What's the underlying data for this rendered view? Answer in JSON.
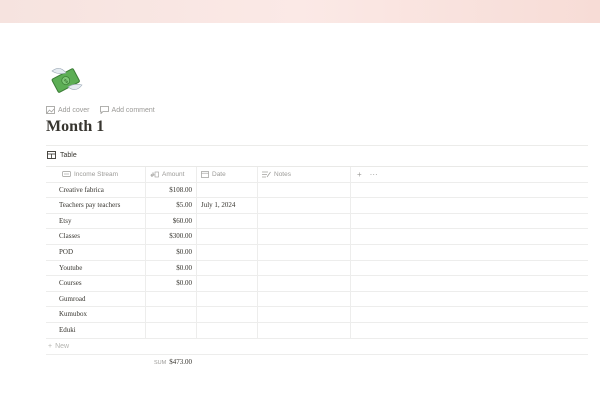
{
  "page": {
    "title": "Month 1",
    "cover_actions": {
      "add_cover": "Add cover",
      "add_comment": "Add comment"
    },
    "icon": "money-with-wings-icon",
    "cover_color": "#f6e3df"
  },
  "view": {
    "label": "Table"
  },
  "table": {
    "columns": [
      "Income Stream",
      "Amount",
      "Date",
      "Notes"
    ],
    "rows": [
      {
        "stream": "Creative fabrica",
        "amount": "$108.00",
        "date": "",
        "notes": ""
      },
      {
        "stream": "Teachers pay teachers",
        "amount": "$5.00",
        "date": "July 1, 2024",
        "notes": ""
      },
      {
        "stream": "Etsy",
        "amount": "$60.00",
        "date": "",
        "notes": ""
      },
      {
        "stream": "Classes",
        "amount": "$300.00",
        "date": "",
        "notes": ""
      },
      {
        "stream": "POD",
        "amount": "$0.00",
        "date": "",
        "notes": ""
      },
      {
        "stream": "Youtube",
        "amount": "$0.00",
        "date": "",
        "notes": ""
      },
      {
        "stream": "Courses",
        "amount": "$0.00",
        "date": "",
        "notes": ""
      },
      {
        "stream": "Gumroad",
        "amount": "",
        "date": "",
        "notes": ""
      },
      {
        "stream": "Kumubox",
        "amount": "",
        "date": "",
        "notes": ""
      },
      {
        "stream": "Eduki",
        "amount": "",
        "date": "",
        "notes": ""
      }
    ],
    "new_label": "New",
    "sum_label": "SUM",
    "sum_value": "$473.00"
  }
}
